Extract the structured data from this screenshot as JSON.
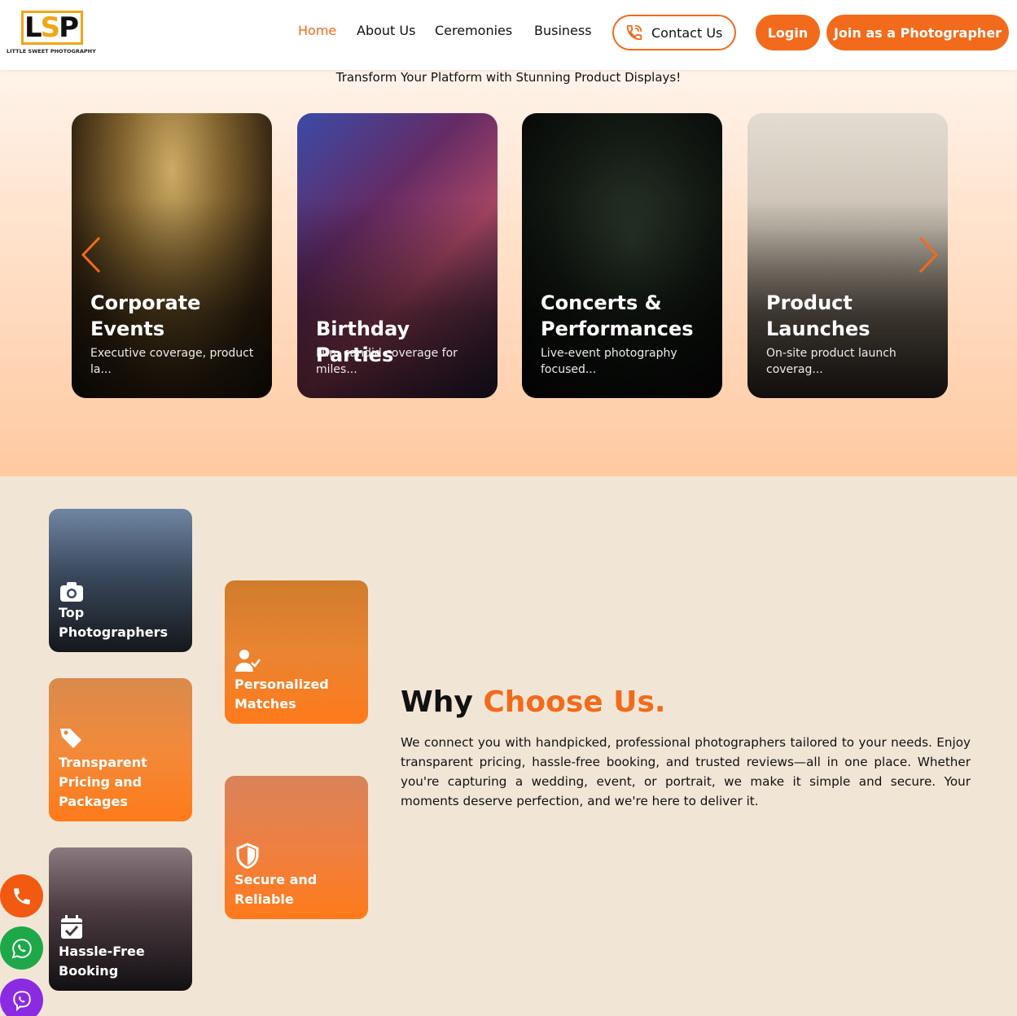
{
  "brand": {
    "logo_letters": "LSP",
    "tagline": "LITTLE SWEET PHOTOGRAPHY"
  },
  "nav": {
    "home": "Home",
    "about": "About Us",
    "ceremonies": "Ceremonies",
    "business": "Business",
    "contact": "Contact Us",
    "login": "Login",
    "join": "Join as a Photographer",
    "active_color": "#f26a1b"
  },
  "hero": {
    "tagline": "Transform Your Platform with Stunning Product Displays!",
    "cards": [
      {
        "title": "Corporate Events",
        "desc": "Executive coverage, product la..."
      },
      {
        "title": "Birthday Parties",
        "desc": "Fun, candid coverage for miles..."
      },
      {
        "title": "Concerts & Performances",
        "desc": "Live-event photography focused..."
      },
      {
        "title": "Product Launches",
        "desc": "On-site product launch coverag..."
      }
    ],
    "prev_icon": "chevron-left-icon",
    "next_icon": "chevron-right-icon"
  },
  "why": {
    "title_part1": "Why ",
    "title_part2": "Choose Us.",
    "text": "We connect you with handpicked, professional photographers tailored to your needs. Enjoy transparent pricing, hassle-free booking, and trusted reviews—all in one place. Whether you're capturing a wedding, event, or portrait, we make it simple and secure. Your moments deserve perfection, and we're here to deliver it.",
    "features": [
      {
        "label": "Top Photographers",
        "icon": "camera-icon"
      },
      {
        "label": "Personalized Matches",
        "icon": "user-check-icon"
      },
      {
        "label": "Transparent Pricing and Packages",
        "icon": "tags-icon"
      },
      {
        "label": "Secure and Reliable",
        "icon": "shield-icon"
      },
      {
        "label": "Hassle-Free Booking",
        "icon": "calendar-check-icon"
      }
    ]
  },
  "floating": {
    "call": "phone-icon",
    "whatsapp": "whatsapp-icon",
    "viber": "viber-icon"
  },
  "colors": {
    "accent": "#f26a1b",
    "section_bg": "#f1e6d6"
  }
}
